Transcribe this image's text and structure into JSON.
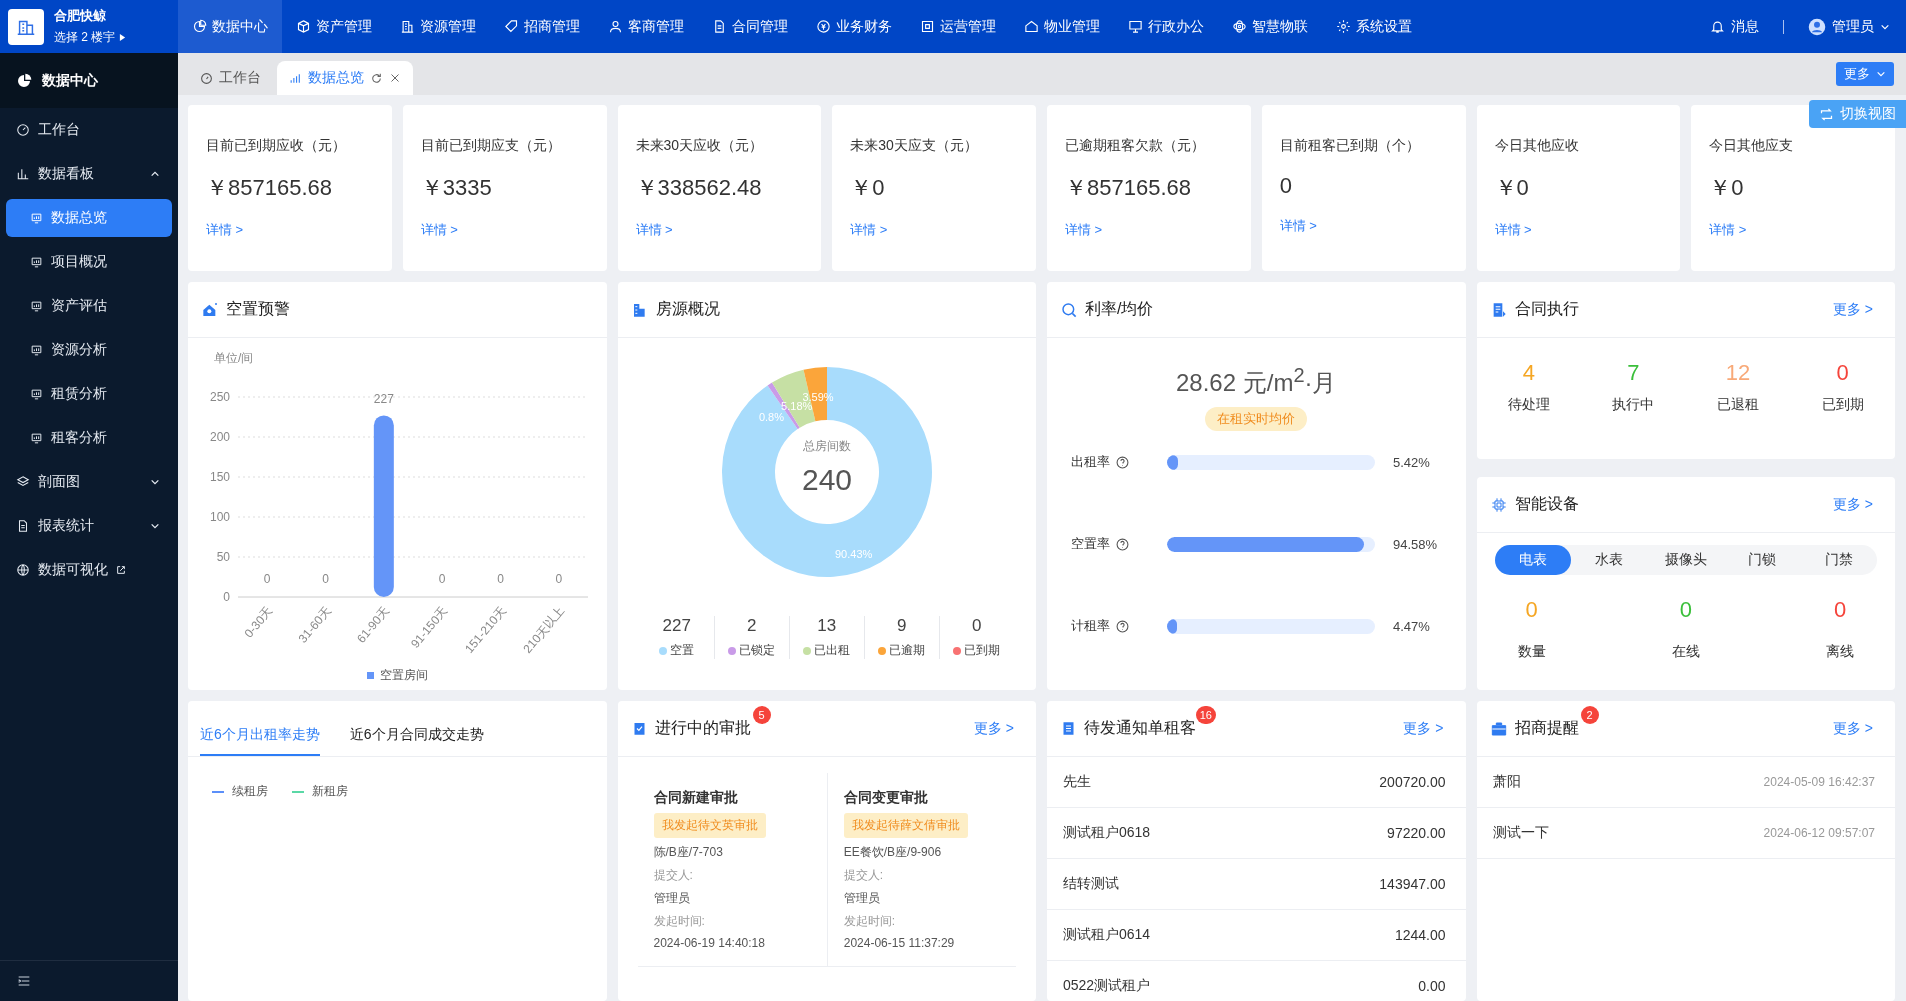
{
  "app": {
    "name": "合肥快鲸",
    "subtitle": "选择 2 楼宇"
  },
  "top_nav": [
    {
      "label": "数据中心",
      "selected": true
    },
    {
      "label": "资产管理",
      "selected": false
    },
    {
      "label": "资源管理",
      "selected": false
    },
    {
      "label": "招商管理",
      "selected": false
    },
    {
      "label": "客商管理",
      "selected": false
    },
    {
      "label": "合同管理",
      "selected": false
    },
    {
      "label": "业务财务",
      "selected": false
    },
    {
      "label": "运营管理",
      "selected": false
    },
    {
      "label": "物业管理",
      "selected": false
    },
    {
      "label": "行政办公",
      "selected": false
    },
    {
      "label": "智慧物联",
      "selected": false
    },
    {
      "label": "系统设置",
      "selected": false
    }
  ],
  "top_right": {
    "messages": "消息",
    "user": "管理员"
  },
  "sidebar": {
    "title": "数据中心",
    "items": [
      {
        "label": "工作台",
        "kind": "link"
      },
      {
        "label": "数据看板",
        "kind": "group",
        "expanded": true,
        "children": [
          {
            "label": "数据总览",
            "selected": true
          },
          {
            "label": "项目概况",
            "selected": false
          },
          {
            "label": "资产评估",
            "selected": false
          },
          {
            "label": "资源分析",
            "selected": false
          },
          {
            "label": "租赁分析",
            "selected": false
          },
          {
            "label": "租客分析",
            "selected": false
          }
        ]
      },
      {
        "label": "剖面图",
        "kind": "group",
        "expanded": false
      },
      {
        "label": "报表统计",
        "kind": "group",
        "expanded": false
      },
      {
        "label": "数据可视化",
        "kind": "external"
      }
    ]
  },
  "tabs": [
    {
      "label": "工作台",
      "selected": false
    },
    {
      "label": "数据总览",
      "selected": true
    }
  ],
  "more_button": "更多",
  "switch_view": "切换视图",
  "stat_cards": [
    {
      "label": "目前已到期应收（元）",
      "value": "￥857165.68",
      "link": "详情 >"
    },
    {
      "label": "目前已到期应支（元）",
      "value": "￥3335",
      "link": "详情 >"
    },
    {
      "label": "未来30天应收（元）",
      "value": "￥338562.48",
      "link": "详情 >"
    },
    {
      "label": "未来30天应支（元）",
      "value": "￥0",
      "link": "详情 >"
    },
    {
      "label": "已逾期租客欠款（元）",
      "value": "￥857165.68",
      "link": "详情 >"
    },
    {
      "label": "目前租客已到期（个）",
      "value": "0",
      "link": "详情 >"
    },
    {
      "label": "今日其他应收",
      "value": "￥0",
      "link": "详情 >"
    },
    {
      "label": "今日其他应支",
      "value": "￥0",
      "link": "详情 >"
    }
  ],
  "vacancy_panel": {
    "title": "空置预警",
    "unit": "单位/间",
    "chart_data": {
      "type": "bar",
      "categories": [
        "0-30天",
        "31-60天",
        "61-90天",
        "91-150天",
        "151-210天",
        "210天以上"
      ],
      "series": [
        {
          "name": "空置房间",
          "color": "#6495f8",
          "values": [
            0,
            0,
            227,
            0,
            0,
            0
          ]
        }
      ],
      "ylim": [
        0,
        250
      ],
      "yticks": [
        0,
        50,
        100,
        150,
        200,
        250
      ],
      "grid": true,
      "data_labels": true
    }
  },
  "housing_panel": {
    "title": "房源概况",
    "center_label": "总房间数",
    "center_value": "240",
    "chart_data": {
      "type": "donut",
      "categories": [
        "空置",
        "已锁定",
        "已出租",
        "已逾期",
        "已到期"
      ],
      "series": [
        {
          "values": [
            90.43,
            0.8,
            5.18,
            3.59,
            0
          ]
        }
      ],
      "value_labels": [
        "90.43%",
        "0.8%",
        "5.18%",
        "3.59%",
        null
      ]
    },
    "stats": [
      {
        "count": "227",
        "color": "#a8dcfc"
      },
      {
        "count": "2",
        "color": "#c99be8"
      },
      {
        "count": "13",
        "color": "#c6e0a4"
      },
      {
        "count": "9",
        "color": "#fba53a"
      },
      {
        "count": "0",
        "color": "#f87272"
      }
    ]
  },
  "rate_panel": {
    "title": "利率/均价",
    "price": "28.62 元/m$^{2}$·月",
    "tag": "在租实时均价",
    "rates": [
      {
        "label": "出租率",
        "level": 0.0542,
        "reading": "5.42%"
      },
      {
        "label": "空置率",
        "level": 0.9458,
        "reading": "94.58%"
      },
      {
        "label": "计租率",
        "level": 0.0447,
        "reading": "4.47%"
      }
    ]
  },
  "contract_panel": {
    "title": "合同执行",
    "more": "更多 >",
    "items": [
      {
        "value": "4",
        "label": "待处理",
        "color": "#f5a623"
      },
      {
        "value": "7",
        "label": "执行中",
        "color": "#3bbf3b"
      },
      {
        "value": "12",
        "label": "已退租",
        "color": "#f8a978"
      },
      {
        "value": "0",
        "label": "已到期",
        "color": "#f5443b"
      }
    ]
  },
  "device_panel": {
    "title": "智能设备",
    "more": "更多 >",
    "tabs": [
      {
        "label": "电表",
        "selected": true
      },
      {
        "label": "水表",
        "selected": false
      },
      {
        "label": "摄像头",
        "selected": false
      },
      {
        "label": "门锁",
        "selected": false
      },
      {
        "label": "门禁",
        "selected": false
      }
    ],
    "items": [
      {
        "value": "0",
        "label": "数量",
        "color": "#f5a623"
      },
      {
        "value": "0",
        "label": "在线",
        "color": "#3bbf3b"
      },
      {
        "value": "0",
        "label": "离线",
        "color": "#f5443b"
      }
    ]
  },
  "trend_panel": {
    "tabs": [
      {
        "label": "近6个月出租率走势",
        "selected": true
      },
      {
        "label": "近6个月合同成交走势",
        "selected": false
      }
    ],
    "legend": [
      {
        "label": "续租房",
        "color": "#5b8ff9"
      },
      {
        "label": "新租房",
        "color": "#5ad8a6"
      }
    ]
  },
  "approval_panel": {
    "title": "进行中的审批",
    "badge": "5",
    "more": "更多 >",
    "items": [
      {
        "title": "合同新建审批",
        "tag": "我发起待文英审批",
        "location": "陈/B座/7-703",
        "submitter_label": "提交人:",
        "submitter": "管理员",
        "time_label": "发起时间:",
        "time": "2024-06-19 14:40:18"
      },
      {
        "title": "合同变更审批",
        "tag": "我发起待薛文倩审批",
        "location": "EE餐饮/B座/9-906",
        "submitter_label": "提交人:",
        "submitter": "管理员",
        "time_label": "发起时间:",
        "time": "2024-06-15 11:37:29"
      }
    ]
  },
  "notice_panel": {
    "title": "待发通知单租客",
    "badge": "16",
    "more": "更多 >",
    "rows": [
      {
        "name": "先生",
        "amount": "200720.00"
      },
      {
        "name": "测试租户0618",
        "amount": "97220.00"
      },
      {
        "name": "结转测试",
        "amount": "143947.00"
      },
      {
        "name": "测试租户0614",
        "amount": "1244.00"
      },
      {
        "name": "0522测试租户",
        "amount": "0.00"
      }
    ]
  },
  "leads_panel": {
    "title": "招商提醒",
    "badge": "2",
    "more": "更多 >",
    "rows": [
      {
        "name": "萧阳",
        "time": "2024-05-09 16:42:37"
      },
      {
        "name": "测试一下",
        "time": "2024-06-12 09:57:07"
      }
    ]
  }
}
